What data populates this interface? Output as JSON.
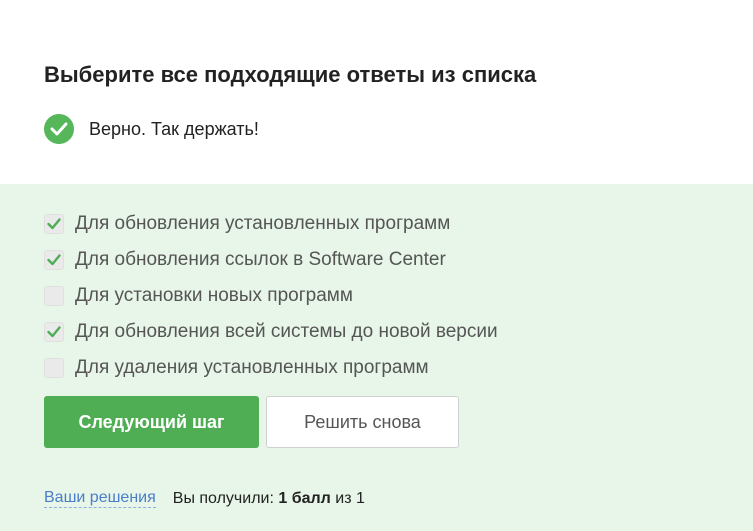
{
  "question": {
    "title": "Выберите все подходящие ответы из списка"
  },
  "feedback": {
    "icon": "check-icon",
    "text": "Верно. Так держать!",
    "color": "#55b65a"
  },
  "options": [
    {
      "label": "Для обновления установленных программ",
      "checked": true
    },
    {
      "label": "Для обновления ссылок в Software Center",
      "checked": true
    },
    {
      "label": "Для установки новых программ",
      "checked": false
    },
    {
      "label": "Для обновления всей системы до новой версии",
      "checked": true
    },
    {
      "label": "Для удаления установленных программ",
      "checked": false
    }
  ],
  "buttons": {
    "next_label": "Следующий шаг",
    "retry_label": "Решить снова"
  },
  "footer": {
    "solutions_link": "Ваши решения",
    "score_prefix": "Вы получили:",
    "score_value": "1 балл",
    "score_suffix": "из 1"
  },
  "colors": {
    "accent": "#4fae54",
    "correct_background": "#e7f6e8",
    "link": "#4a7ec9"
  }
}
